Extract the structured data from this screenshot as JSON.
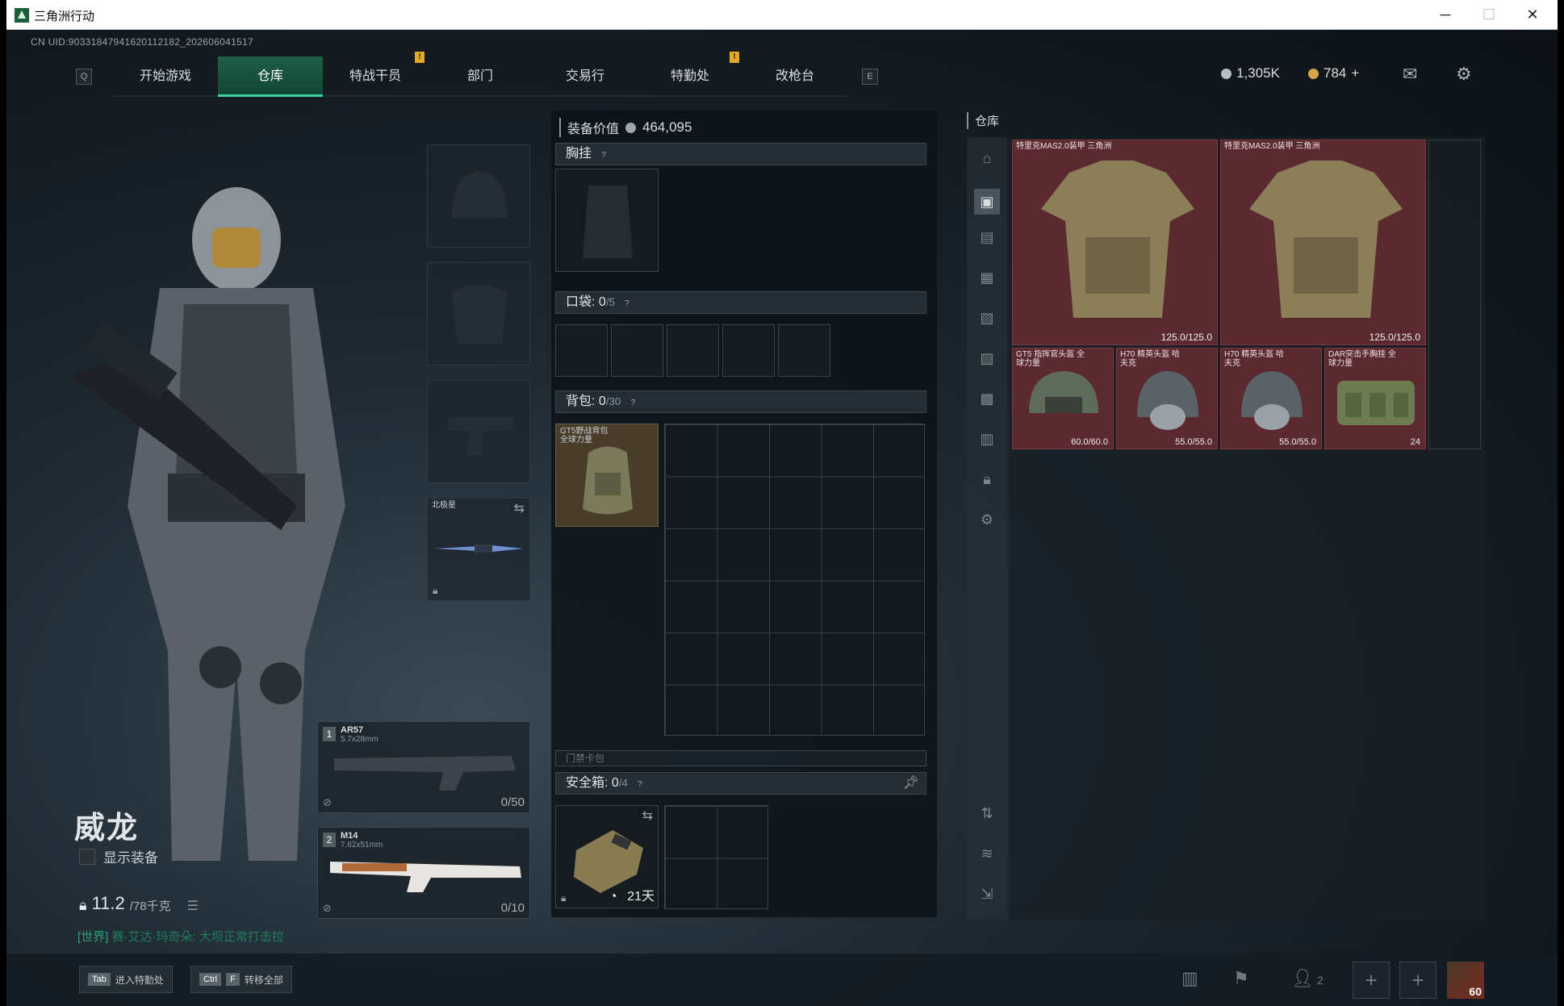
{
  "window": {
    "title": "三角洲行动",
    "minimize": "─",
    "maximize": "☐",
    "close": "✕"
  },
  "uid": "CN UID:9033184794162011​2182_202606041517",
  "nav": {
    "key_left": "Q",
    "key_right": "E",
    "tabs": [
      "开始游戏",
      "仓库",
      "特战干员",
      "部门",
      "交易行",
      "特勤处",
      "改枪台"
    ],
    "active_tab": "仓库",
    "badge": "!"
  },
  "currency": {
    "silver": "1,305K",
    "gold": "784",
    "gold_add": "+"
  },
  "operator": {
    "name": "威龙",
    "show_equipment": "显示装备",
    "weight": "11.2",
    "weight_max": "/78千克",
    "chat_channel": "[世界]",
    "chat_text": "赛·艾达·玛奇朵: 大坝正常打击拉"
  },
  "gear_slots": {
    "melee_label": "北极星",
    "weapon1": {
      "num": "1",
      "name": "AR57",
      "caliber": "5.7x28mm",
      "ammo": "0/50"
    },
    "weapon2": {
      "num": "2",
      "name": "M14",
      "caliber": "7.62x51mm",
      "ammo": "0/10"
    }
  },
  "loadout": {
    "value_label": "装备价值",
    "value": "464,095",
    "chest_label": "胸挂",
    "pocket_label": "口袋:",
    "pocket_count": "0",
    "pocket_max": "/5",
    "backpack_label": "背包:",
    "backpack_count": "0",
    "backpack_max": "/30",
    "backpack_item": "GT5野战背包 全球力量",
    "keycard_label": "门禁卡包",
    "safe_label": "安全箱:",
    "safe_count": "0",
    "safe_max": "/4",
    "safe_timer": "21天",
    "help": "?"
  },
  "warehouse": {
    "title": "仓库",
    "items": [
      {
        "name": "特里克MAS2.0装甲 三角洲",
        "durability": "125.0/125.0"
      },
      {
        "name": "特里克MAS2.0装甲 三角洲",
        "durability": "125.0/125.0"
      },
      {
        "name": "GT5 指挥官头盔 全球力量",
        "durability": "60.0/60.0"
      },
      {
        "name": "H70 精英头盔 哈夫克",
        "durability": "55.0/55.0"
      },
      {
        "name": "H70 精英头盔 哈夫克",
        "durability": "55.0/55.0"
      },
      {
        "name": "DAR突击手胸挂 全球力量",
        "durability": "24"
      }
    ]
  },
  "bottom": {
    "hint1_key": "Tab",
    "hint1": "进入特勤处",
    "hint2_key1": "Ctrl",
    "hint2_key2": "F",
    "hint2": "转移全部",
    "friends": "2",
    "level": "60"
  }
}
